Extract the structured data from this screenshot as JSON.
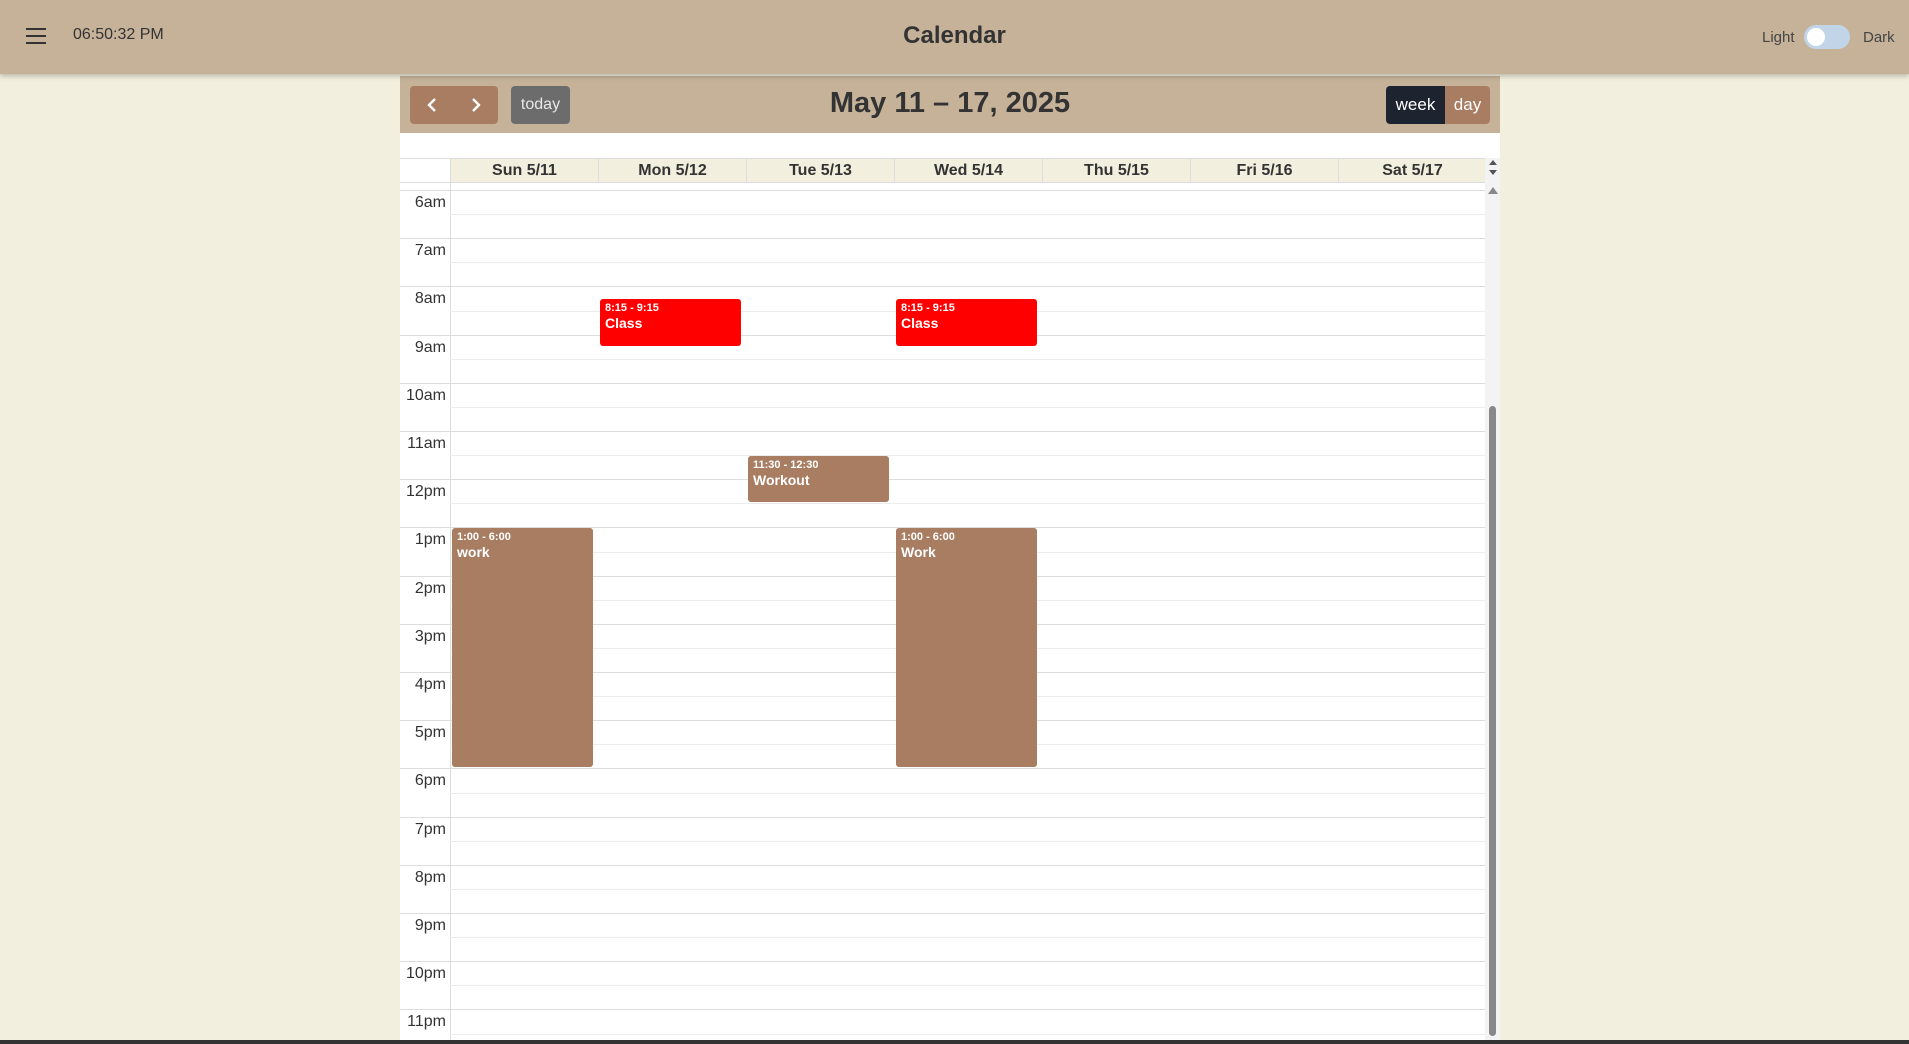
{
  "header": {
    "clock": "06:50:32 PM",
    "title": "Calendar",
    "theme_light_label": "Light",
    "theme_dark_label": "Dark"
  },
  "toolbar": {
    "prev_icon": "chevron-left-icon",
    "next_icon": "chevron-right-icon",
    "today_label": "today",
    "range_title": "May 11 – 17, 2025",
    "view_week_label": "week",
    "view_day_label": "day",
    "active_view": "week"
  },
  "days": [
    "Sun 5/11",
    "Mon 5/12",
    "Tue 5/13",
    "Wed 5/14",
    "Thu 5/15",
    "Fri 5/16",
    "Sat 5/17"
  ],
  "hours": [
    "6am",
    "7am",
    "8am",
    "9am",
    "10am",
    "11am",
    "12pm",
    "1pm",
    "2pm",
    "3pm",
    "4pm",
    "5pm",
    "6pm",
    "7pm",
    "8pm",
    "9pm",
    "10pm",
    "11pm"
  ],
  "events": [
    {
      "day": 1,
      "start": 8.25,
      "end": 9.25,
      "time": "8:15 - 9:15",
      "title": "Class",
      "color": "#ff0000"
    },
    {
      "day": 3,
      "start": 8.25,
      "end": 9.25,
      "time": "8:15 - 9:15",
      "title": "Class",
      "color": "#ff0000"
    },
    {
      "day": 2,
      "start": 11.5,
      "end": 12.5,
      "time": "11:30 - 12:30",
      "title": "Workout",
      "color": "#a87d62"
    },
    {
      "day": 0,
      "start": 13,
      "end": 18,
      "time": "1:00 - 6:00",
      "title": "work",
      "color": "#a87d62"
    },
    {
      "day": 3,
      "start": 13,
      "end": 18,
      "time": "1:00 - 6:00",
      "title": "Work",
      "color": "#a87d62"
    }
  ],
  "colors": {
    "header_bg": "#c5b299",
    "page_bg": "#f3efde",
    "accent_brown": "#a87d62",
    "active_view_bg": "#1d2430"
  }
}
